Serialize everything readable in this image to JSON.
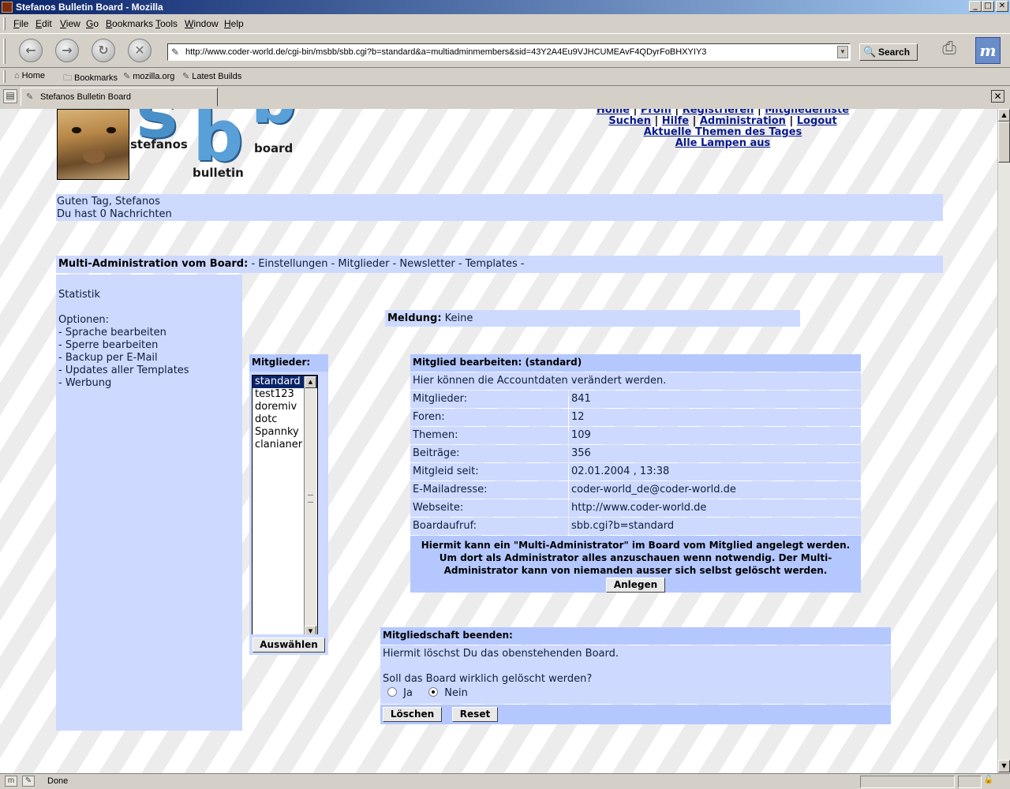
{
  "window": {
    "title": "Stefanos Bulletin Board - Mozilla",
    "buttons": {
      "minimize": "_",
      "maximize": "□",
      "close": "✕"
    }
  },
  "menu": [
    "File",
    "Edit",
    "View",
    "Go",
    "Bookmarks",
    "Tools",
    "Window",
    "Help"
  ],
  "nav": {
    "url": "http://www.coder-world.de/cgi-bin/msbb/sbb.cgi?b=standard&a=multiadminmembers&sid=43Y2A4Eu9VJHCUMEAvF4QDyrFoBHXYIY3",
    "search_label": "Search"
  },
  "bookmarks": [
    "Home",
    "Bookmarks",
    "mozilla.org",
    "Latest Builds"
  ],
  "tab": {
    "label": "Stefanos Bulletin Board"
  },
  "status": {
    "text": "Done"
  },
  "logo": {
    "word1": "stefanos",
    "word2": "board",
    "word3": "bulletin"
  },
  "topnav": {
    "home": "Home",
    "profil": "Profil",
    "registrieren": "Registrieren",
    "mitgliederliste": "Mitgliederliste",
    "suchen": "Suchen",
    "hilfe": "Hilfe",
    "administration": "Administration",
    "logout": "Logout",
    "aktuelle": "Aktuelle Themen des Tages",
    "lampen": "Alle Lampen aus",
    "sep": "|"
  },
  "greeting": {
    "line1": "Guten Tag, Stefanos",
    "line2": "Du hast 0 Nachrichten"
  },
  "multibar": {
    "title": "Multi-Administration vom Board:",
    "sep": "-",
    "links": [
      "Einstellungen",
      "Mitglieder",
      "Newsletter",
      "Templates"
    ]
  },
  "sidebar": {
    "statistik": "Statistik",
    "optionen": "Optionen:",
    "items": [
      "- Sprache bearbeiten",
      "- Sperre bearbeiten",
      "- Backup per E-Mail",
      "- Updates aller Templates",
      "- Werbung"
    ]
  },
  "meldung": {
    "label": "Meldung:",
    "value": "Keine"
  },
  "members": {
    "header": "Mitglieder:",
    "options": [
      "standard",
      "test123",
      "doremiv",
      "dotc",
      "Spannky",
      "clanianer"
    ],
    "selected": "standard",
    "button": "Auswählen"
  },
  "edit": {
    "header": "Mitglied bearbeiten: (standard)",
    "description": "Hier können die Accountdaten verändert werden.",
    "rows": [
      {
        "label": "Mitglieder:",
        "value": "841"
      },
      {
        "label": "Foren:",
        "value": "12"
      },
      {
        "label": "Themen:",
        "value": "109"
      },
      {
        "label": "Beiträge:",
        "value": "356"
      },
      {
        "label": "Mitgleid seit:",
        "value": "02.01.2004 , 13:38"
      },
      {
        "label": "E-Mailadresse:",
        "value": "coder-world_de@coder-world.de"
      },
      {
        "label": "Webseite:",
        "value": "http://www.coder-world.de"
      },
      {
        "label": "Boardaufruf:",
        "value": "sbb.cgi?b=standard"
      }
    ],
    "note": "Hiermit kann ein \"Multi-Administrator\" im Board vom Mitglied angelegt werden. Um dort als Administrator alles anzuschauen wenn notwendig. Der Multi-Administrator kann von niemanden ausser sich selbst gelöscht werden.",
    "button": "Anlegen"
  },
  "end": {
    "header": "Mitgliedschaft beenden:",
    "line1": "Hiermit löschst Du das obenstehenden Board.",
    "question": "Soll das Board wirklich gelöscht werden?",
    "yes": "Ja",
    "no": "Nein",
    "selected": "Nein",
    "delete_button": "Löschen",
    "reset_button": "Reset"
  }
}
